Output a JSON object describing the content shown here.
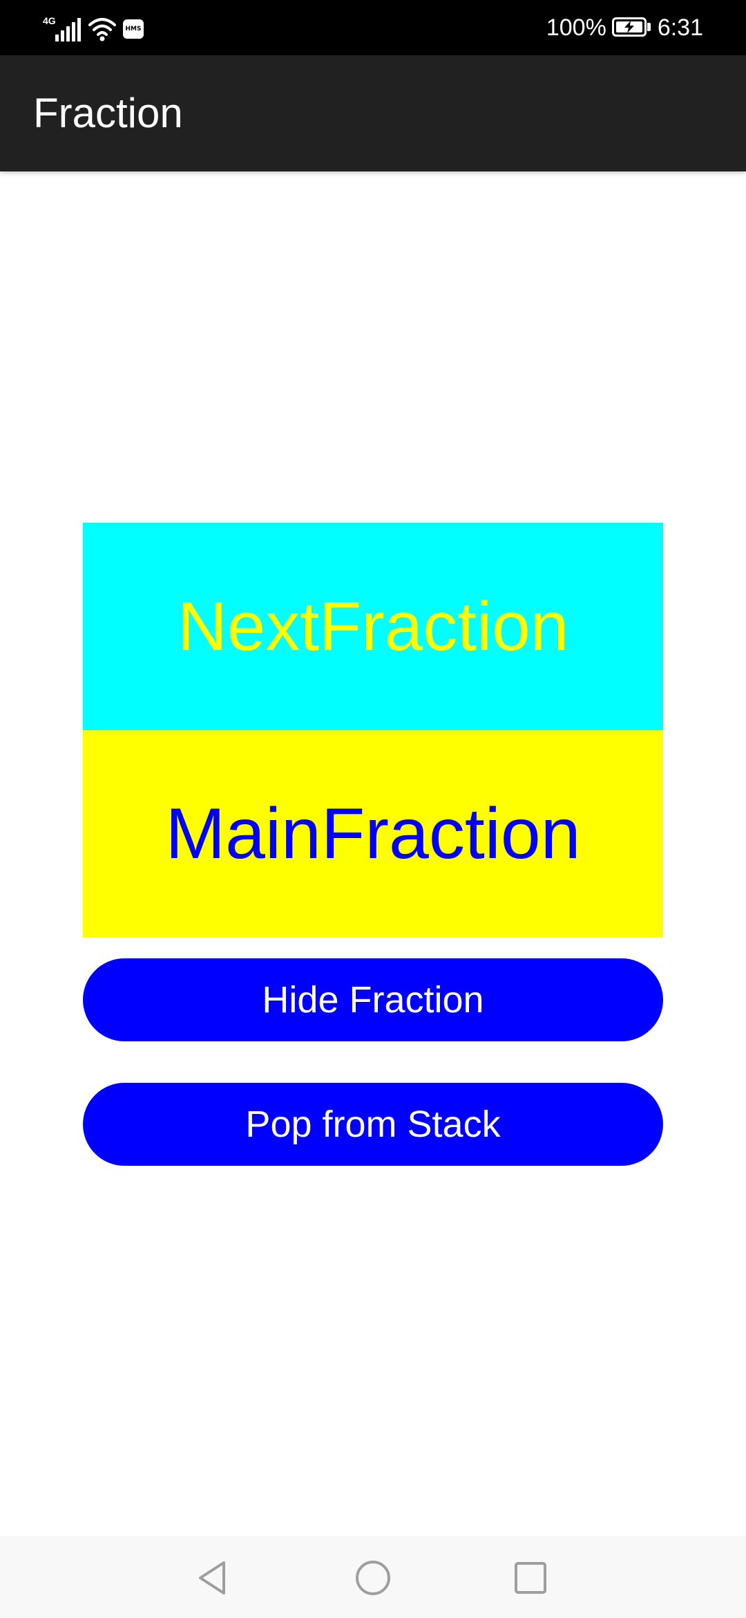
{
  "status_bar": {
    "network": "4G",
    "badge": "HMS",
    "battery": "100%",
    "time": "6:31"
  },
  "app_bar": {
    "title": "Fraction"
  },
  "fractions": {
    "next_label": "NextFraction",
    "main_label": "MainFraction"
  },
  "buttons": {
    "hide_label": "Hide Fraction",
    "pop_label": "Pop from Stack"
  },
  "nav_bar": {
    "icons": [
      "back-icon",
      "home-icon",
      "recent-apps-icon"
    ]
  },
  "colors": {
    "app_bar": "#212121",
    "next_fraction_bg": "#00ffff",
    "next_fraction_text": "#ffff00",
    "main_fraction_bg": "#ffff00",
    "main_fraction_text": "#0000ff",
    "button_bg": "#0000ff",
    "button_text": "#ffffff"
  }
}
